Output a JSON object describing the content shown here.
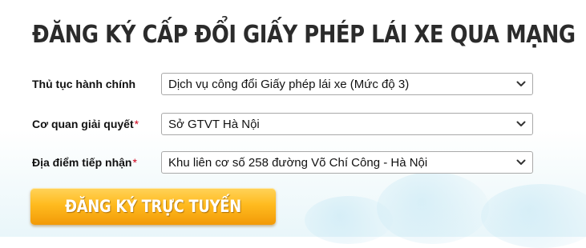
{
  "header": {
    "title": "ĐĂNG KÝ CẤP ĐỔI GIẤY PHÉP LÁI XE QUA MẠNG"
  },
  "form": {
    "procedure": {
      "label": "Thủ tục hành chính",
      "required": false,
      "selected_value": "Dịch vụ công đổi Giấy phép lái xe (Mức độ 3)"
    },
    "agency": {
      "label": "Cơ quan giải quyết",
      "required": true,
      "required_marker": "*",
      "selected_value": "Sở GTVT Hà Nội"
    },
    "location": {
      "label": "Địa điểm tiếp nhận",
      "required": true,
      "required_marker": "*",
      "selected_value": "Khu liên cơ số 258 đường Võ Chí Công - Hà Nội"
    },
    "submit": {
      "label": "ĐĂNG KÝ TRỰC TUYẾN"
    }
  },
  "colors": {
    "required_marker": "#d0021b",
    "button_top": "#ffd35a",
    "button_bottom": "#f29a07",
    "title_text": "#2b2b2b"
  },
  "icons": {
    "dropdown": "chevron-down-icon"
  }
}
